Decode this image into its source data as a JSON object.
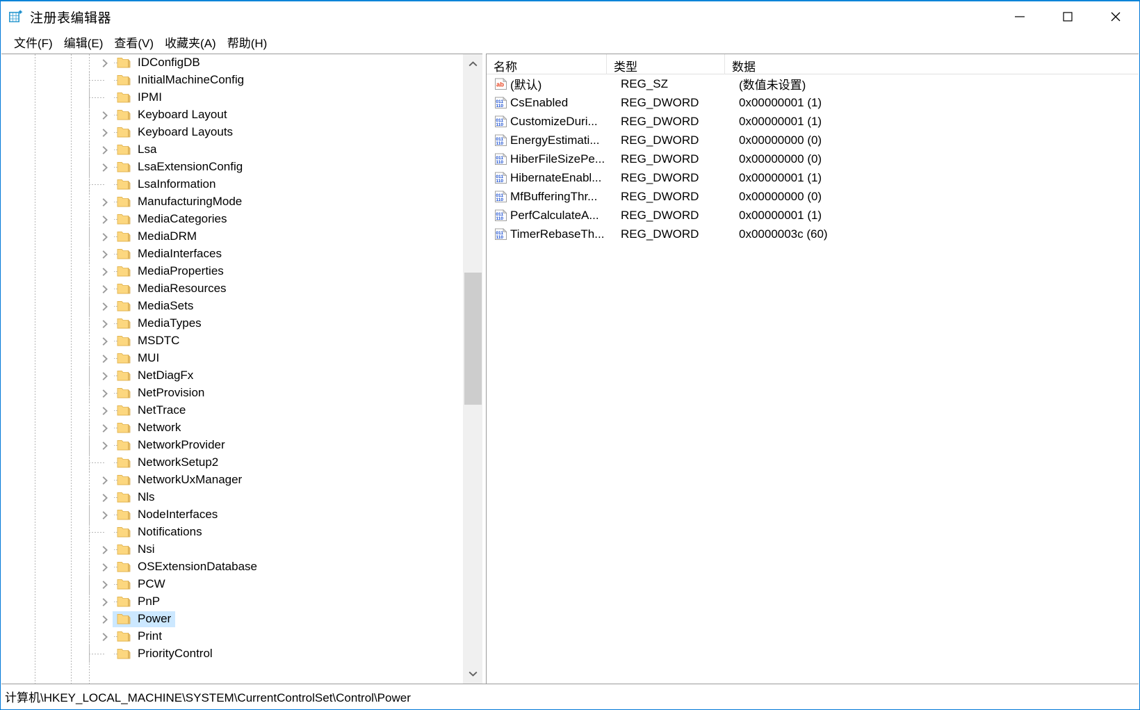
{
  "window": {
    "title": "注册表编辑器",
    "icon": "registry-editor-icon",
    "minimize_label": "—",
    "maximize_label": "□",
    "close_label": "✕"
  },
  "menu": {
    "items": [
      {
        "label": "文件(F)"
      },
      {
        "label": "编辑(E)"
      },
      {
        "label": "查看(V)"
      },
      {
        "label": "收藏夹(A)"
      },
      {
        "label": "帮助(H)"
      }
    ]
  },
  "tree": {
    "nodes": [
      {
        "label": "IDConfigDB",
        "expandable": true,
        "selected": false
      },
      {
        "label": "InitialMachineConfig",
        "expandable": false,
        "selected": false
      },
      {
        "label": "IPMI",
        "expandable": false,
        "selected": false
      },
      {
        "label": "Keyboard Layout",
        "expandable": true,
        "selected": false
      },
      {
        "label": "Keyboard Layouts",
        "expandable": true,
        "selected": false
      },
      {
        "label": "Lsa",
        "expandable": true,
        "selected": false
      },
      {
        "label": "LsaExtensionConfig",
        "expandable": true,
        "selected": false
      },
      {
        "label": "LsaInformation",
        "expandable": false,
        "selected": false
      },
      {
        "label": "ManufacturingMode",
        "expandable": true,
        "selected": false
      },
      {
        "label": "MediaCategories",
        "expandable": true,
        "selected": false
      },
      {
        "label": "MediaDRM",
        "expandable": true,
        "selected": false
      },
      {
        "label": "MediaInterfaces",
        "expandable": true,
        "selected": false
      },
      {
        "label": "MediaProperties",
        "expandable": true,
        "selected": false
      },
      {
        "label": "MediaResources",
        "expandable": true,
        "selected": false
      },
      {
        "label": "MediaSets",
        "expandable": true,
        "selected": false
      },
      {
        "label": "MediaTypes",
        "expandable": true,
        "selected": false
      },
      {
        "label": "MSDTC",
        "expandable": true,
        "selected": false
      },
      {
        "label": "MUI",
        "expandable": true,
        "selected": false
      },
      {
        "label": "NetDiagFx",
        "expandable": true,
        "selected": false
      },
      {
        "label": "NetProvision",
        "expandable": true,
        "selected": false
      },
      {
        "label": "NetTrace",
        "expandable": true,
        "selected": false
      },
      {
        "label": "Network",
        "expandable": true,
        "selected": false
      },
      {
        "label": "NetworkProvider",
        "expandable": true,
        "selected": false
      },
      {
        "label": "NetworkSetup2",
        "expandable": false,
        "selected": false
      },
      {
        "label": "NetworkUxManager",
        "expandable": true,
        "selected": false
      },
      {
        "label": "Nls",
        "expandable": true,
        "selected": false
      },
      {
        "label": "NodeInterfaces",
        "expandable": true,
        "selected": false
      },
      {
        "label": "Notifications",
        "expandable": false,
        "selected": false
      },
      {
        "label": "Nsi",
        "expandable": true,
        "selected": false
      },
      {
        "label": "OSExtensionDatabase",
        "expandable": true,
        "selected": false
      },
      {
        "label": "PCW",
        "expandable": true,
        "selected": false
      },
      {
        "label": "PnP",
        "expandable": true,
        "selected": false
      },
      {
        "label": "Power",
        "expandable": true,
        "selected": true
      },
      {
        "label": "Print",
        "expandable": true,
        "selected": false
      },
      {
        "label": "PriorityControl",
        "expandable": false,
        "selected": false
      }
    ]
  },
  "values": {
    "columns": [
      {
        "label": "名称"
      },
      {
        "label": "类型"
      },
      {
        "label": "数据"
      }
    ],
    "rows": [
      {
        "name": "(默认)",
        "type": "REG_SZ",
        "data": "(数值未设置)",
        "icon": "string-value-icon"
      },
      {
        "name": "CsEnabled",
        "type": "REG_DWORD",
        "data": "0x00000001 (1)",
        "icon": "dword-value-icon"
      },
      {
        "name": "CustomizeDuri...",
        "type": "REG_DWORD",
        "data": "0x00000001 (1)",
        "icon": "dword-value-icon"
      },
      {
        "name": "EnergyEstimati...",
        "type": "REG_DWORD",
        "data": "0x00000000 (0)",
        "icon": "dword-value-icon"
      },
      {
        "name": "HiberFileSizePe...",
        "type": "REG_DWORD",
        "data": "0x00000000 (0)",
        "icon": "dword-value-icon"
      },
      {
        "name": "HibernateEnabl...",
        "type": "REG_DWORD",
        "data": "0x00000001 (1)",
        "icon": "dword-value-icon"
      },
      {
        "name": "MfBufferingThr...",
        "type": "REG_DWORD",
        "data": "0x00000000 (0)",
        "icon": "dword-value-icon"
      },
      {
        "name": "PerfCalculateA...",
        "type": "REG_DWORD",
        "data": "0x00000001 (1)",
        "icon": "dword-value-icon"
      },
      {
        "name": "TimerRebaseTh...",
        "type": "REG_DWORD",
        "data": "0x0000003c (60)",
        "icon": "dword-value-icon"
      }
    ]
  },
  "statusbar": {
    "path": "计算机\\HKEY_LOCAL_MACHINE\\SYSTEM\\CurrentControlSet\\Control\\Power"
  },
  "colors": {
    "accent": "#0078d7",
    "selection": "#cce8ff",
    "folder": "#fcd77f",
    "scrollbar_thumb": "#cdcdcd",
    "chevron": "#9a9a9a"
  }
}
